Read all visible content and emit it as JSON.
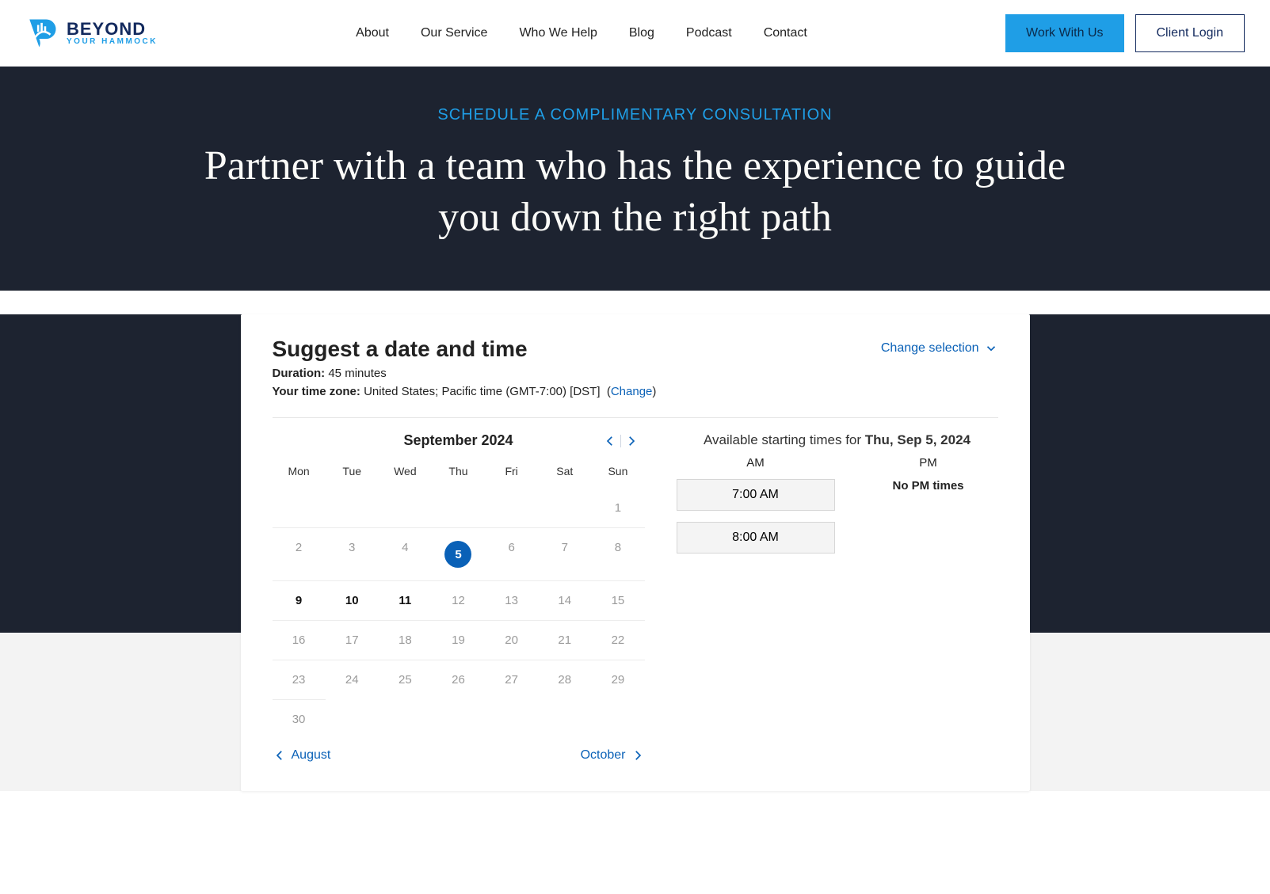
{
  "brand": {
    "line1": "BEYOND",
    "line2": "YOUR HAMMOCK"
  },
  "nav": {
    "about": "About",
    "service": "Our Service",
    "who": "Who We Help",
    "blog": "Blog",
    "podcast": "Podcast",
    "contact": "Contact"
  },
  "cta": {
    "primary": "Work With Us",
    "secondary": "Client Login"
  },
  "hero": {
    "eyebrow": "SCHEDULE A COMPLIMENTARY CONSULTATION",
    "title": "Partner with a team who has the experience to guide you down the right path"
  },
  "scheduler": {
    "title": "Suggest a date and time",
    "change_selection": "Change selection",
    "duration_label": "Duration:",
    "duration_value": "45 minutes",
    "tz_label": "Your time zone:",
    "tz_value": "United States;  Pacific time  (GMT-7:00) [DST]",
    "tz_change": "Change",
    "month_label": "September 2024",
    "dow": [
      "Mon",
      "Tue",
      "Wed",
      "Thu",
      "Fri",
      "Sat",
      "Sun"
    ],
    "prev_month": "August",
    "next_month": "October",
    "times_prefix": "Available starting times for ",
    "times_date": "Thu, Sep 5, 2024",
    "am_label": "AM",
    "pm_label": "PM",
    "am_slots": [
      "7:00 AM",
      "8:00 AM"
    ],
    "no_pm": "No PM times",
    "days": [
      {
        "n": "",
        "cls": "lead"
      },
      {
        "n": "",
        "cls": "lead"
      },
      {
        "n": "",
        "cls": "lead"
      },
      {
        "n": "",
        "cls": "lead"
      },
      {
        "n": "",
        "cls": "lead"
      },
      {
        "n": "",
        "cls": "lead"
      },
      {
        "n": "1",
        "cls": "lead"
      },
      {
        "n": "2",
        "cls": ""
      },
      {
        "n": "3",
        "cls": ""
      },
      {
        "n": "4",
        "cls": ""
      },
      {
        "n": "5",
        "cls": "sel avail"
      },
      {
        "n": "6",
        "cls": ""
      },
      {
        "n": "7",
        "cls": ""
      },
      {
        "n": "8",
        "cls": ""
      },
      {
        "n": "9",
        "cls": "avail"
      },
      {
        "n": "10",
        "cls": "avail"
      },
      {
        "n": "11",
        "cls": "avail"
      },
      {
        "n": "12",
        "cls": ""
      },
      {
        "n": "13",
        "cls": ""
      },
      {
        "n": "14",
        "cls": ""
      },
      {
        "n": "15",
        "cls": ""
      },
      {
        "n": "16",
        "cls": ""
      },
      {
        "n": "17",
        "cls": ""
      },
      {
        "n": "18",
        "cls": ""
      },
      {
        "n": "19",
        "cls": ""
      },
      {
        "n": "20",
        "cls": ""
      },
      {
        "n": "21",
        "cls": ""
      },
      {
        "n": "22",
        "cls": ""
      },
      {
        "n": "23",
        "cls": ""
      },
      {
        "n": "24",
        "cls": ""
      },
      {
        "n": "25",
        "cls": ""
      },
      {
        "n": "26",
        "cls": ""
      },
      {
        "n": "27",
        "cls": ""
      },
      {
        "n": "28",
        "cls": ""
      },
      {
        "n": "29",
        "cls": ""
      },
      {
        "n": "30",
        "cls": ""
      }
    ]
  }
}
